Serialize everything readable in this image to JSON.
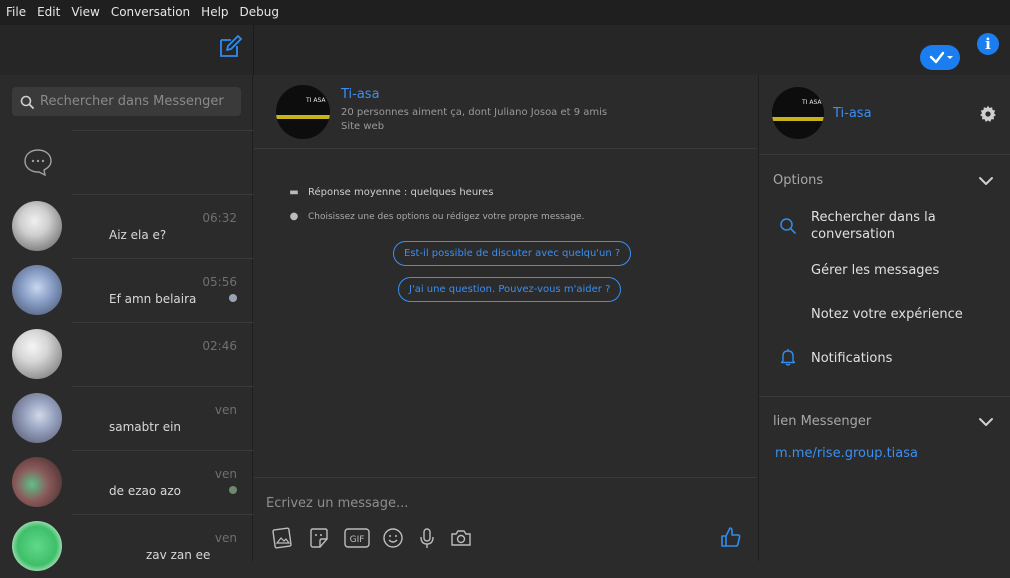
{
  "menubar": [
    "File",
    "Edit",
    "View",
    "Conversation",
    "Help",
    "Debug"
  ],
  "info_label": "i",
  "search": {
    "placeholder": "Rechercher dans Messenger"
  },
  "conversations": [
    {
      "time": "06:32",
      "snippet": "Aiz ela e?",
      "seen": false
    },
    {
      "time": "05:56",
      "snippet": "Ef amn belaira",
      "seen": true
    },
    {
      "time": "02:46",
      "snippet": "",
      "seen": false
    },
    {
      "time": "ven",
      "snippet": "samabtr ein",
      "seen": false
    },
    {
      "time": "ven",
      "snippet": "de ezao azo",
      "seen": true
    },
    {
      "time": "ven",
      "snippet": "zav zan ee",
      "seen": false
    }
  ],
  "page": {
    "name": "Ti-asa",
    "likes": "20 personnes aiment ça, dont Juliano Josoa et 9 amis",
    "category": "Site web",
    "avatar_text": "TI ASA"
  },
  "conversation": {
    "response_time": "Réponse moyenne : quelques heures",
    "hint": "Choisissez une des options ou rédigez votre propre message.",
    "quick_replies": [
      "Est-il possible de discuter avec quelqu'un ?",
      "J'ai une question. Pouvez-vous m'aider ?"
    ],
    "composer_placeholder": "Écrivez un message..."
  },
  "details": {
    "options_title": "Options",
    "options": [
      "Rechercher dans la conversation",
      "Gérer les messages",
      "Notez votre expérience",
      "Notifications"
    ],
    "link_title": "lien Messenger",
    "link": "m.me/rise.group.tiasa"
  },
  "colors": {
    "accent": "#1b7ef0",
    "link": "#3b8ff2",
    "background": "#2b2b2b",
    "menubar": "#1f1f1f"
  },
  "icons": [
    "compose-icon",
    "checkmark-icon",
    "info-icon",
    "search-icon",
    "chat-bubble-icon",
    "gallery-icon",
    "sticker-icon",
    "gif-icon",
    "emoji-icon",
    "microphone-icon",
    "camera-icon",
    "thumbs-up-icon",
    "gear-icon",
    "chevron-down-icon",
    "bell-icon"
  ]
}
